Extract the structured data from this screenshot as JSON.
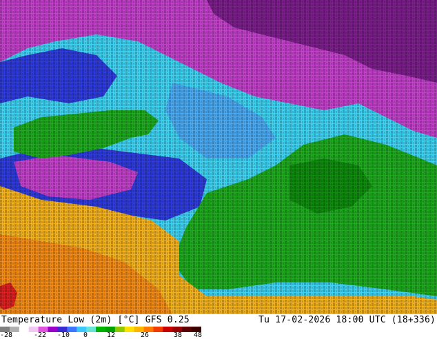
{
  "product": {
    "title": "Temperature Low (2m) [°C] GFS 0.25",
    "valid_time": "Tu 17-02-2026 18:00 UTC (18+336)"
  },
  "legend": {
    "ticks": [
      "-28",
      "-22",
      "-10",
      "0",
      "12",
      "26",
      "38",
      "48"
    ],
    "colors": [
      "#7f7f7f",
      "#b0b0b0",
      "#ffffff",
      "#f0c8f0",
      "#dd55dd",
      "#9a00c8",
      "#3a2ad2",
      "#3c78ff",
      "#3cc8ff",
      "#6ae4d2",
      "#00b400",
      "#00a000",
      "#90c800",
      "#ffe100",
      "#ffb400",
      "#ff7800",
      "#f03c00",
      "#c80000",
      "#960000",
      "#5a0000",
      "#3a0000"
    ]
  },
  "map": {
    "palette": {
      "deep_purple": "#7a1e8a",
      "magenta": "#c040c8",
      "blue": "#2f3bd8",
      "light_blue": "#4aa8f0",
      "cyan": "#3fd0f0",
      "green": "#1fa81f",
      "dark_green": "#0f8a0f",
      "yellow_orange": "#f0b020",
      "orange": "#f08a18",
      "red": "#d82020"
    }
  }
}
